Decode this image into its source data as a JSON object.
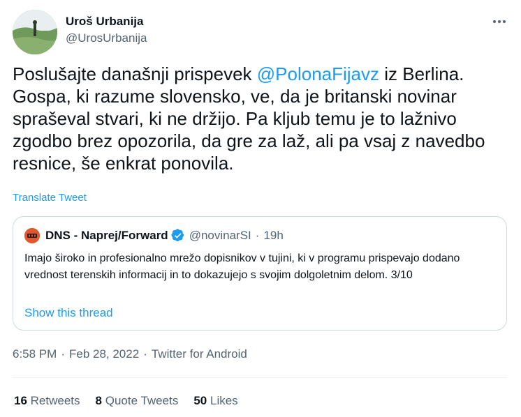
{
  "author": {
    "display_name": "Uroš Urbanija",
    "handle": "@UrosUrbanija"
  },
  "tweet": {
    "text_before": "Poslušajte današnji prispevek ",
    "mention": "@PolonaFijavz",
    "text_after": " iz Berlina. Gospa, ki razume slovensko, ve, da je britanski novinar spraševal stvari, ki ne držijo. Pa kljub temu je to lažnivo zgodbo brez opozorila, da gre za laž, ali pa vsaj z navedbo resnice, še enkrat ponovila.",
    "translate_label": "Translate Tweet"
  },
  "quote": {
    "name": "DNS - Naprej/Forward",
    "handle": "@novinarSI",
    "dot": "·",
    "time": "19h",
    "text": "Imajo široko in profesionalno mrežo dopisnikov v tujini, ki v programu prispevajo dodano vrednost terenskih informacij in to dokazujejo s svojim dolgoletnim delom. 3/10",
    "show_thread": "Show this thread"
  },
  "meta": {
    "time": "6:58 PM",
    "dot1": "·",
    "date": "Feb 28, 2022",
    "dot2": "·",
    "source": "Twitter for Android"
  },
  "stats": {
    "retweets_count": "16",
    "retweets_label": "Retweets",
    "quotes_count": "8",
    "quotes_label": "Quote Tweets",
    "likes_count": "50",
    "likes_label": "Likes"
  },
  "colors": {
    "link": "#1d9bf0",
    "secondary_text": "#536471",
    "border": "#cfd9de",
    "verified": "#1d9bf0"
  },
  "icons": {
    "more": "more-horizontal-icon",
    "verified": "verified-badge-icon"
  }
}
